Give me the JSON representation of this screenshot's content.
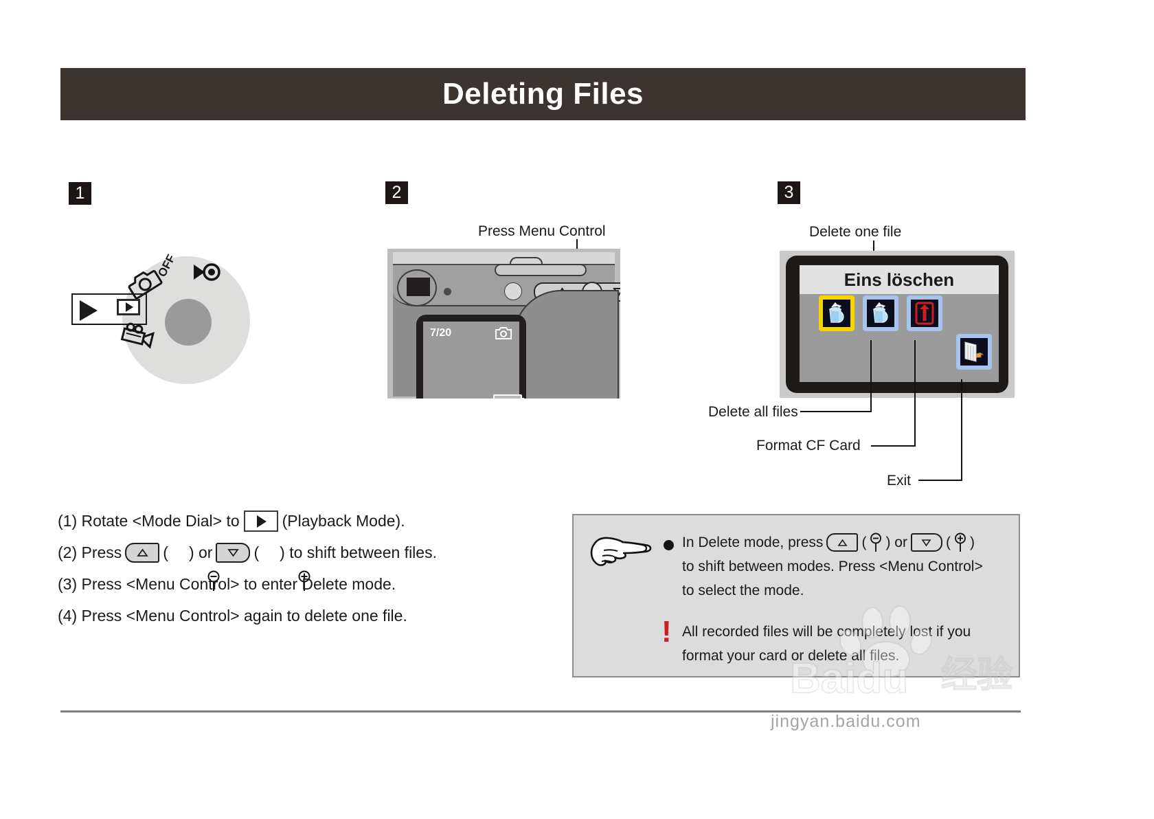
{
  "header": {
    "title": "Deleting Files"
  },
  "steps": {
    "one": "1",
    "two": "2",
    "three": "3"
  },
  "panel1": {
    "dial_off_label": "OFF",
    "icons": {
      "camera": "camera-icon",
      "sound": "sound-playback-icon",
      "video": "video-camera-icon",
      "playback": "playback-icon"
    }
  },
  "panel2": {
    "callout": "Press Menu Control",
    "lcd_counter": "7/20",
    "icons": {
      "up_button": "up-arrow-button",
      "down_button": "down-arrow-button",
      "menu_button": "menu-control-button",
      "camera_mode": "camera-mode-icon",
      "battery": "battery-icon"
    }
  },
  "panel3": {
    "menu_title": "Eins löschen",
    "callout_top": "Delete one file",
    "labels": {
      "delete_all": "Delete all files",
      "format_cf": "Format CF Card",
      "exit": "Exit"
    },
    "icons": {
      "delete_one": "trash-can-icon",
      "delete_all": "trash-can-icon",
      "format": "format-card-icon",
      "exit": "exit-door-icon"
    },
    "colors": {
      "selected_highlight": "#f5d400",
      "unselected_highlight": "#a8c4ea",
      "format_red": "#d01e1e"
    }
  },
  "instructions": [
    {
      "id": "step-1",
      "prefix": "(1) Rotate <Mode Dial> to",
      "icon": "playback-icon",
      "suffix": "(Playback Mode)."
    },
    {
      "id": "step-2",
      "prefix": "(2) Press",
      "btn_up": "up-arrow-button",
      "mid_open": "(",
      "sym_minus": "macro-minus-icon",
      "mid_close": ") or",
      "btn_down": "down-arrow-button",
      "end_open": "(",
      "sym_plus": "macro-plus-icon",
      "end_close": ") to shift between files."
    },
    {
      "id": "step-3",
      "text": "(3) Press <Menu Control> to enter Delete mode."
    },
    {
      "id": "step-4",
      "text": "(4) Press <Menu Control> again to delete one file."
    }
  ],
  "note": {
    "hand_icon": "pointing-hand-icon",
    "bullet_line_1_a": "In Delete mode, press",
    "bullet_line_1_b": "(",
    "bullet_line_1_c": ") or",
    "bullet_line_1_d": "(",
    "bullet_line_1_e": ")",
    "bullet_line_2": "to shift between modes. Press <Menu Control>",
    "bullet_line_3": "to select the mode.",
    "warning_mark": "!",
    "warning_line_1": "All recorded files will be completely lost if you",
    "warning_line_2": "format your card or delete all files.",
    "warning_color": "#cc1f1f"
  },
  "watermark": {
    "brand": "Baidu",
    "brand_cn": "经验",
    "url": "jingyan.baidu.com"
  }
}
